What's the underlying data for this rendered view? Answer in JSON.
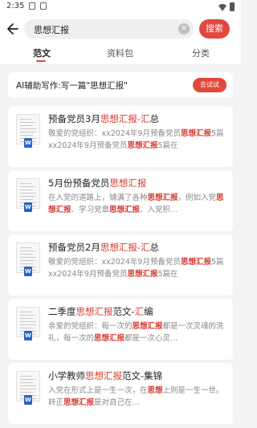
{
  "status_bar": {
    "time": "2:35"
  },
  "search": {
    "query": "思想汇报",
    "button_label": "搜索"
  },
  "tabs": [
    {
      "label": "范文",
      "active": true
    },
    {
      "label": "资料包",
      "active": false
    },
    {
      "label": "分类",
      "active": false
    }
  ],
  "ai_banner": {
    "text": "AI辅助写作:写一篇\"思想汇报\"",
    "button_label": "去试试"
  },
  "colors": {
    "accent": "#e2483d",
    "highlight": "#d8392f",
    "word_badge": "#2a63c6"
  },
  "results": [
    {
      "title": [
        {
          "t": "预备党员3月",
          "h": false
        },
        {
          "t": "思想汇报",
          "h": true
        },
        {
          "t": "-汇",
          "h": true
        },
        {
          "t": "总",
          "h": false
        }
      ],
      "snippet": [
        {
          "t": "敬爱的党组织：xx2024年9月预备党员",
          "h": false
        },
        {
          "t": "思想汇报",
          "h": true
        },
        {
          "t": "5篇xx2024年9月预备党员",
          "h": false
        },
        {
          "t": "思想汇报",
          "h": true
        },
        {
          "t": "5篇在",
          "h": false
        }
      ]
    },
    {
      "title": [
        {
          "t": "5月份预备党员",
          "h": false
        },
        {
          "t": "思想汇报",
          "h": true
        }
      ],
      "snippet": [
        {
          "t": "在入党的道路上，铺满了各种",
          "h": false
        },
        {
          "t": "思想汇报",
          "h": true
        },
        {
          "t": "，例如入党",
          "h": false
        },
        {
          "t": "思想汇报",
          "h": true
        },
        {
          "t": "、学习党章",
          "h": false
        },
        {
          "t": "思想汇报",
          "h": true
        },
        {
          "t": "、入党积…",
          "h": false
        }
      ]
    },
    {
      "title": [
        {
          "t": "预备党员2月",
          "h": false
        },
        {
          "t": "思想汇报",
          "h": true
        },
        {
          "t": "-汇",
          "h": true
        },
        {
          "t": "总",
          "h": false
        }
      ],
      "snippet": [
        {
          "t": "敬爱的党组织：xx2024年9月预备党员",
          "h": false
        },
        {
          "t": "思想汇报",
          "h": true
        },
        {
          "t": "5篇xx2024年9月预备党员",
          "h": false
        },
        {
          "t": "思想汇报",
          "h": true
        },
        {
          "t": "5篇在",
          "h": false
        }
      ]
    },
    {
      "title": [
        {
          "t": "二季度",
          "h": false
        },
        {
          "t": "思想汇报",
          "h": true
        },
        {
          "t": "范文-",
          "h": false
        },
        {
          "t": "汇",
          "h": true
        },
        {
          "t": "编",
          "h": false
        }
      ],
      "snippet": [
        {
          "t": "亲爱的党组织：每一次的",
          "h": false
        },
        {
          "t": "思想汇报",
          "h": true
        },
        {
          "t": "都是一次灵魂的洗礼，每一次的",
          "h": false
        },
        {
          "t": "思想汇报",
          "h": true
        },
        {
          "t": "都是一次心灵…",
          "h": false
        }
      ]
    },
    {
      "title": [
        {
          "t": "小学教师",
          "h": false
        },
        {
          "t": "思想汇报",
          "h": true
        },
        {
          "t": "范文-集锦",
          "h": false
        }
      ],
      "snippet": [
        {
          "t": "入党在形式上是一生一次，在",
          "h": false
        },
        {
          "t": "思想",
          "h": true
        },
        {
          "t": "上则是一生一世。转正",
          "h": false
        },
        {
          "t": "思想汇报",
          "h": true
        },
        {
          "t": "是对自己在…",
          "h": false
        }
      ]
    }
  ]
}
